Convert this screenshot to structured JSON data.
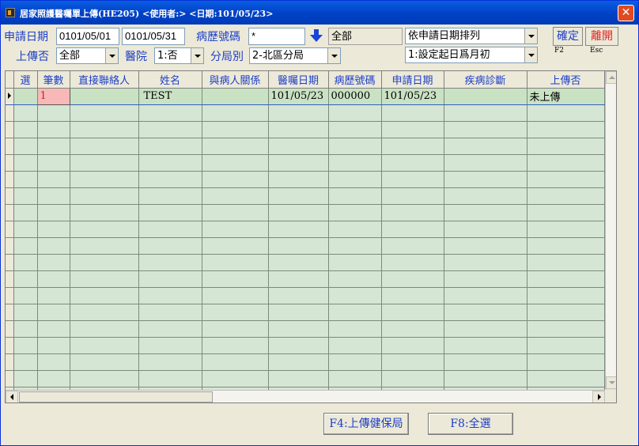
{
  "window": {
    "title": "居家照護醫囑單上傳(HE205)   <使用者:>   <日期:101/05/23>",
    "close_label": "✕"
  },
  "form": {
    "apply_date_label": "申請日期",
    "date_from": "0101/05/01",
    "date_to": "0101/05/31",
    "chart_no_label": "病歷號碼",
    "chart_no_value": "*",
    "chart_no_display": "全部",
    "sort_value": "依申請日期排列",
    "upload_label": "上傳否",
    "upload_value": "全部",
    "hospital_label": "醫院",
    "hospital_value": "1:否",
    "branch_label": "分局別",
    "branch_value": "2-北區分局",
    "start_date_option": "1:設定起日爲月初",
    "confirm_label": "確定",
    "confirm_hint": "F2",
    "exit_label": "離開",
    "exit_hint": "Esc"
  },
  "table": {
    "columns": [
      "選",
      "筆數",
      "直接聯絡人",
      "姓名",
      "與病人關係",
      "醫囑日期",
      "病歷號碼",
      "申請日期",
      "疾病診斷",
      "上傳否"
    ],
    "rows": [
      [
        "",
        "1",
        "",
        "TEST",
        "",
        "101/05/23",
        "000000",
        "101/05/23",
        "",
        "未上傳"
      ]
    ]
  },
  "actions": {
    "upload_button": "F4:上傳健保局",
    "select_all_button": "F8:全選"
  }
}
